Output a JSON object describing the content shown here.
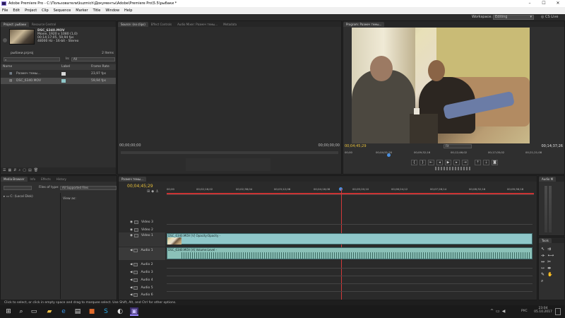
{
  "window": {
    "title": "Adobe Premiere Pro - C:\\Пользователи\\kuzmich\\Документы\\Adobe\\Premiere Pro\\5.5\\рыбаки *"
  },
  "menu": [
    "File",
    "Edit",
    "Project",
    "Clip",
    "Sequence",
    "Marker",
    "Title",
    "Window",
    "Help"
  ],
  "workspace": {
    "label": "Workspace:",
    "value": "Editing",
    "cc": "CS Live"
  },
  "project": {
    "tabs": [
      "Project: рыбаки",
      "Resource Central"
    ],
    "clip_info": {
      "name": "DSC_6340.MOV",
      "line1": "Movie, 1920 x 1080 (1,0)",
      "line2": "00;14;17;05, 59,94 fps",
      "line3": "48000 Hz - 16-bit - Stereo"
    },
    "file": "рыбаки.prproj",
    "items": "2 Items",
    "in_label": "In:",
    "in_value": "All",
    "columns": [
      "Name",
      "Label",
      "Frame Rate"
    ],
    "rows": [
      {
        "name": "Размеч темы...",
        "fps": "23,97 fps"
      },
      {
        "name": "DSC_6340.MOV",
        "fps": "59,94 fps"
      }
    ]
  },
  "source": {
    "tabs": [
      "Source: (no clips)",
      "Effect Controls",
      "Audio Mixer: Размеч темы...",
      "Metadata"
    ],
    "tc_left": "00;00;00;00",
    "tc_right": "00;00;00;00"
  },
  "program": {
    "tab": "Program: Размеч темы...",
    "tc_left": "00;04;45;29",
    "fit": "Fit",
    "tc_right": "00;14;37;26",
    "ruler": [
      "00;00",
      "00;04;51;20",
      "00;09;32;16",
      "00;12;46;02",
      "00;17;05;02",
      "00;21;21;08"
    ]
  },
  "media_browser": {
    "tabs": [
      "Media Browser",
      "Info",
      "Effects",
      "History"
    ],
    "files_of_type": "Files of type:",
    "all_supported": "All Supported Files",
    "view_as": "View as:",
    "disk": "C: (Local Disk)"
  },
  "timeline": {
    "tab": "Размеч темы...",
    "tc": "00;04;45;29",
    "ruler": [
      "00;00",
      "00;02;16;02",
      "00;02;38;04",
      "00;03;12;06",
      "00;04;16;08",
      "00;05;20;10",
      "00;06;24;12",
      "00;07;28;14",
      "00;08;32;16",
      "00;09;36;18"
    ],
    "video_tracks": [
      "Video 3",
      "Video 2",
      "Video 1"
    ],
    "audio_tracks": [
      "Audio 1",
      "Audio 2",
      "Audio 3",
      "Audio 4",
      "Audio 5",
      "Audio 6"
    ],
    "video_clip": "DSC_6340.MOV [V]  Opacity:Opacity -",
    "audio_clip": "DSC_6340.MOV [A]  Volume:Level -"
  },
  "right": {
    "audio_master": "Audio M",
    "tools": "Tools"
  },
  "status": "Click to select, or click in empty space and drag to marquee select. Use Shift, Alt, and Ctrl for other options.",
  "taskbar": {
    "lang": "РУС",
    "time": "23:04",
    "date": "05.10.2017"
  }
}
